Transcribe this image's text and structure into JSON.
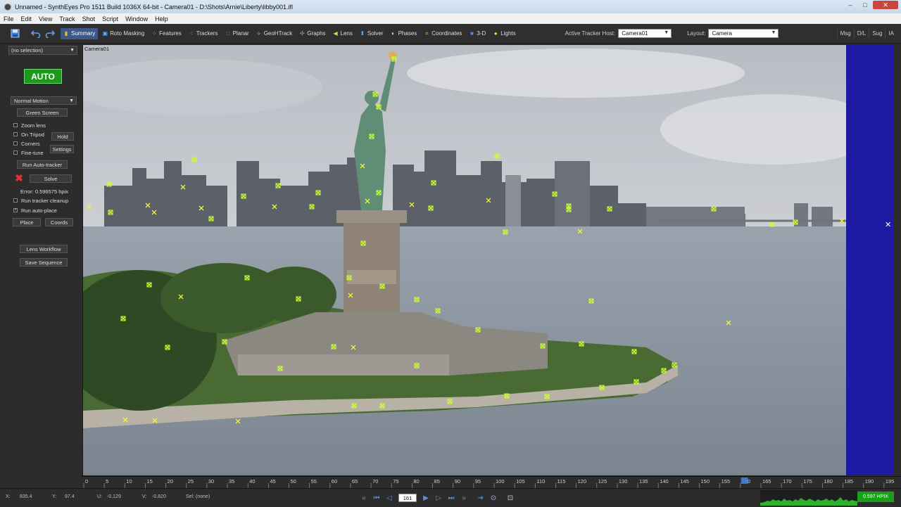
{
  "window": {
    "title": "Unnamed - SynthEyes Pro 1511 Build 1036X 64-bit - Camera01 - D:\\Shots\\Arnie\\Liberty\\libby001.ifl",
    "minimize": "–",
    "maximize": "□",
    "close": "✕"
  },
  "menu": [
    "File",
    "Edit",
    "View",
    "Track",
    "Shot",
    "Script",
    "Window",
    "Help"
  ],
  "toolbar": {
    "tabs": [
      {
        "label": "Summary",
        "icon": "summary-icon",
        "active": true
      },
      {
        "label": "Roto Masking",
        "icon": "roto-icon"
      },
      {
        "label": "Features",
        "icon": "features-icon"
      },
      {
        "label": "Trackers",
        "icon": "trackers-icon"
      },
      {
        "label": "Planar",
        "icon": "planar-icon"
      },
      {
        "label": "GeoHTrack",
        "icon": "geohtrack-icon"
      },
      {
        "label": "Graphs",
        "icon": "graphs-icon"
      },
      {
        "label": "Lens",
        "icon": "lens-icon"
      },
      {
        "label": "Solver",
        "icon": "solver-icon"
      },
      {
        "label": "Phases",
        "icon": "phases-icon"
      },
      {
        "label": "Coordinates",
        "icon": "coordinates-icon"
      },
      {
        "label": "3-D",
        "icon": "cube-icon"
      },
      {
        "label": "Lights",
        "icon": "bulb-icon"
      }
    ],
    "active_tracker_host_label": "Active Tracker Host:",
    "active_tracker_host_value": "Camera01",
    "layout_label": "Layout:",
    "layout_value": "Camera",
    "right_buttons": [
      "Msg",
      "D/L",
      "Sug",
      "IA"
    ]
  },
  "panel": {
    "selection": "(no selection)",
    "auto": "AUTO",
    "motion": "Normal Motion",
    "green_screen": "Green Screen",
    "zoom_lens": "Zoom lens",
    "on_tripod": "On Tripod",
    "hold": "Hold",
    "corners": "Corners",
    "settings": "Settings",
    "fine_tune": "Fine-tune",
    "run_auto_tracker": "Run Auto-tracker",
    "solve": "Solve",
    "error": "Error: 0.596575 hpix",
    "run_tracker_cleanup": "Run tracker cleanup",
    "run_auto_place": "Run auto-place",
    "place": "Place",
    "coords": "Coords",
    "lens_workflow": "Lens Workflow",
    "save_sequence": "Save Sequence"
  },
  "viewport": {
    "label": "Camera01"
  },
  "timeline": {
    "ticks": [
      "0",
      "5",
      "10",
      "15",
      "20",
      "25",
      "30",
      "35",
      "40",
      "45",
      "50",
      "55",
      "60",
      "65",
      "70",
      "75",
      "80",
      "85",
      "90",
      "95",
      "100",
      "105",
      "110",
      "115",
      "120",
      "125",
      "130",
      "135",
      "140",
      "145",
      "150",
      "155",
      "160",
      "165",
      "170",
      "175",
      "180",
      "185",
      "190",
      "195"
    ],
    "current_frame": 161,
    "last_frame_label": "195"
  },
  "status": {
    "x_label": "X:",
    "x_value": "835.4",
    "y_label": "Y:",
    "y_value": "97.4",
    "u_label": "U:",
    "u_value": "-0.129",
    "v_label": "V:",
    "v_value": "-0.820",
    "sel": "Sel: (none)",
    "frame": "161",
    "error_badge": "0.597 HPIX"
  },
  "colors": {
    "tracker_green": "#c8ff30",
    "tracker_yellow": "#f2f23a",
    "auto_green": "#1d9a1d",
    "blue_bg": "#1c1aa0"
  }
}
